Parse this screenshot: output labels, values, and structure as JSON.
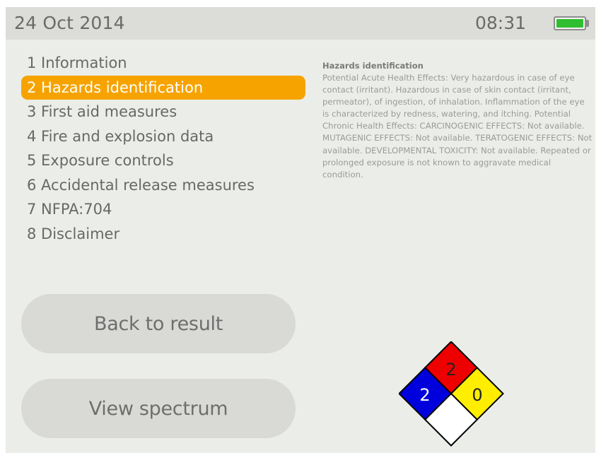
{
  "status_bar": {
    "date": "24 Oct 2014",
    "time": "08:31",
    "battery_icon": "battery-full-icon",
    "battery_color": "#2fbe2f"
  },
  "menu": {
    "items": [
      {
        "label": "1 Information",
        "selected": false
      },
      {
        "label": "2 Hazards identification",
        "selected": true
      },
      {
        "label": "3 First aid measures",
        "selected": false
      },
      {
        "label": "4 Fire and explosion data",
        "selected": false
      },
      {
        "label": "5 Exposure controls",
        "selected": false
      },
      {
        "label": "6 Accidental release measures",
        "selected": false
      },
      {
        "label": "7 NFPA:704",
        "selected": false
      },
      {
        "label": "8 Disclaimer",
        "selected": false
      }
    ],
    "selected_color": "#f6a300"
  },
  "detail": {
    "title": "Hazards identification",
    "body": "Potential Acute Health Effects: Very hazardous in case of eye contact (irritant). Hazardous in case of skin contact (irritant, permeator), of ingestion, of inhalation. Inflammation of the eye is characterized by redness, watering, and itching. Potential Chronic Health Effects: CARCINOGENIC EFFECTS: Not available. MUTAGENIC EFFECTS: Not available. TERATOGENIC EFFECTS: Not available. DEVELOPMENTAL TOXICITY: Not available. Repeated or prolonged exposure is not known to aggravate medical condition."
  },
  "buttons": {
    "back": "Back to result",
    "spectrum": "View spectrum"
  },
  "nfpa_diamond": {
    "flammability": "2",
    "health": "2",
    "instability": "0",
    "special": "",
    "colors": {
      "flammability": "#ee0000",
      "health": "#0000dd",
      "instability": "#ffee00",
      "special": "#ffffff"
    }
  }
}
